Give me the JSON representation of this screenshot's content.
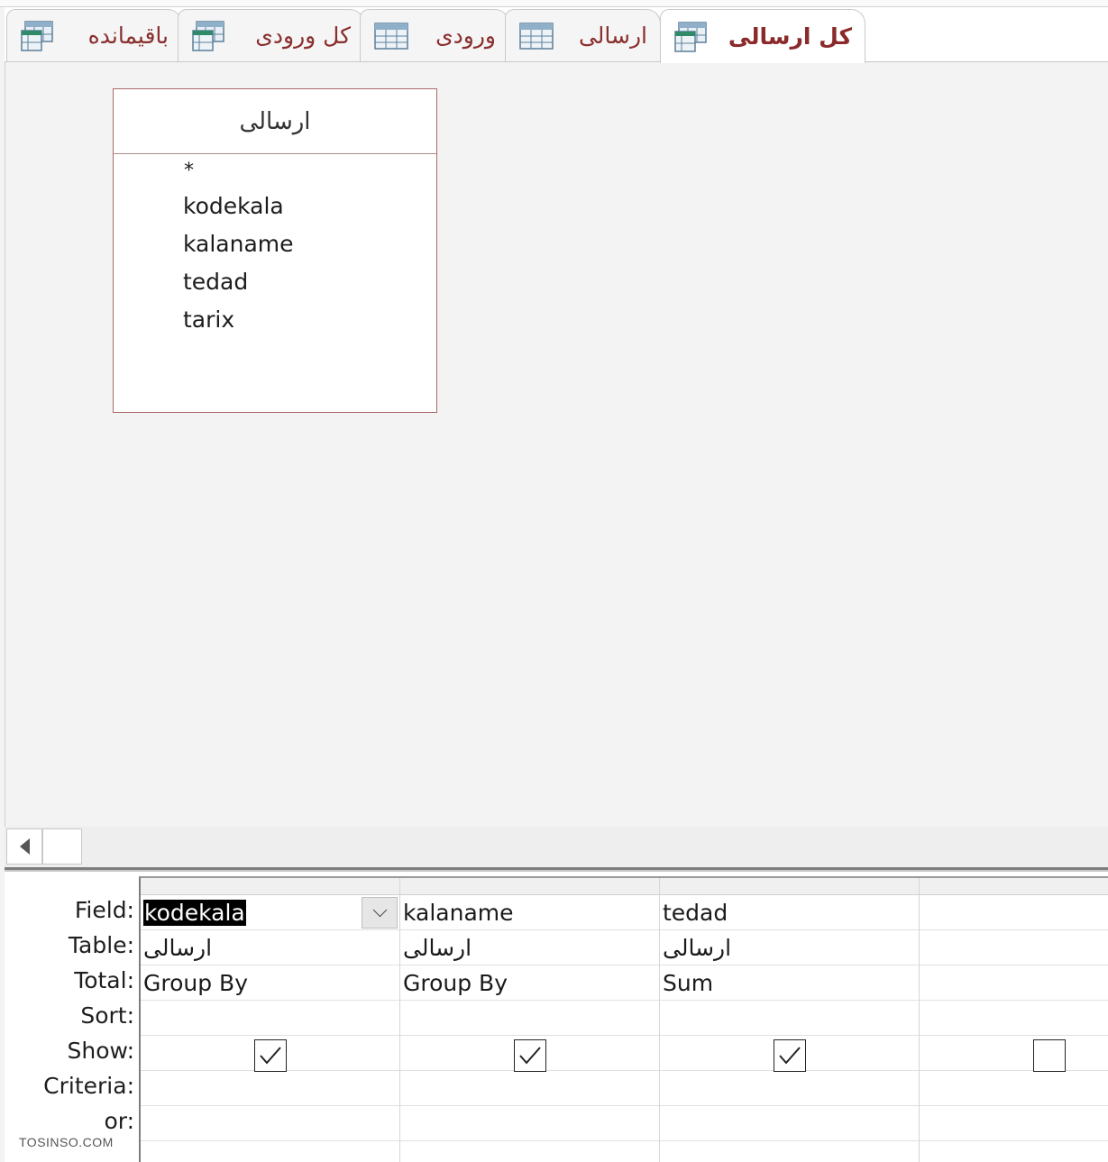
{
  "tabs": [
    {
      "label": "كل ارسالی",
      "icon": "query-icon",
      "active": true
    },
    {
      "label": "ارسالی",
      "icon": "table-icon",
      "active": false
    },
    {
      "label": "ورودی",
      "icon": "table-icon",
      "active": false
    },
    {
      "label": "كل ورودی",
      "icon": "query-icon",
      "active": false
    },
    {
      "label": "باقیمانده",
      "icon": "query-icon",
      "active": false
    }
  ],
  "field_list": {
    "title": "ارسالی",
    "items": [
      "*",
      "kodekala",
      "kalaname",
      "tedad",
      "tarix"
    ]
  },
  "grid": {
    "row_labels": {
      "field": "Field:",
      "table": "Table:",
      "total": "Total:",
      "sort": "Sort:",
      "show": "Show:",
      "criteria": "Criteria:",
      "or": "or:"
    },
    "columns": [
      {
        "field": "kodekala",
        "table": "ارسالی",
        "total": "Group By",
        "sort": "",
        "show": true,
        "criteria": "",
        "or": ""
      },
      {
        "field": "kalaname",
        "table": "ارسالی",
        "total": "Group By",
        "sort": "",
        "show": true,
        "criteria": "",
        "or": ""
      },
      {
        "field": "tedad",
        "table": "ارسالی",
        "total": "Sum",
        "sort": "",
        "show": true,
        "criteria": "",
        "or": ""
      },
      {
        "field": "",
        "table": "",
        "total": "",
        "sort": "",
        "show": false,
        "criteria": "",
        "or": ""
      }
    ]
  },
  "watermark": "TOSINSO.COM",
  "colors": {
    "tab_text": "#8a2e2e",
    "field_list_border": "#a86a6a",
    "selection": "#000000"
  }
}
